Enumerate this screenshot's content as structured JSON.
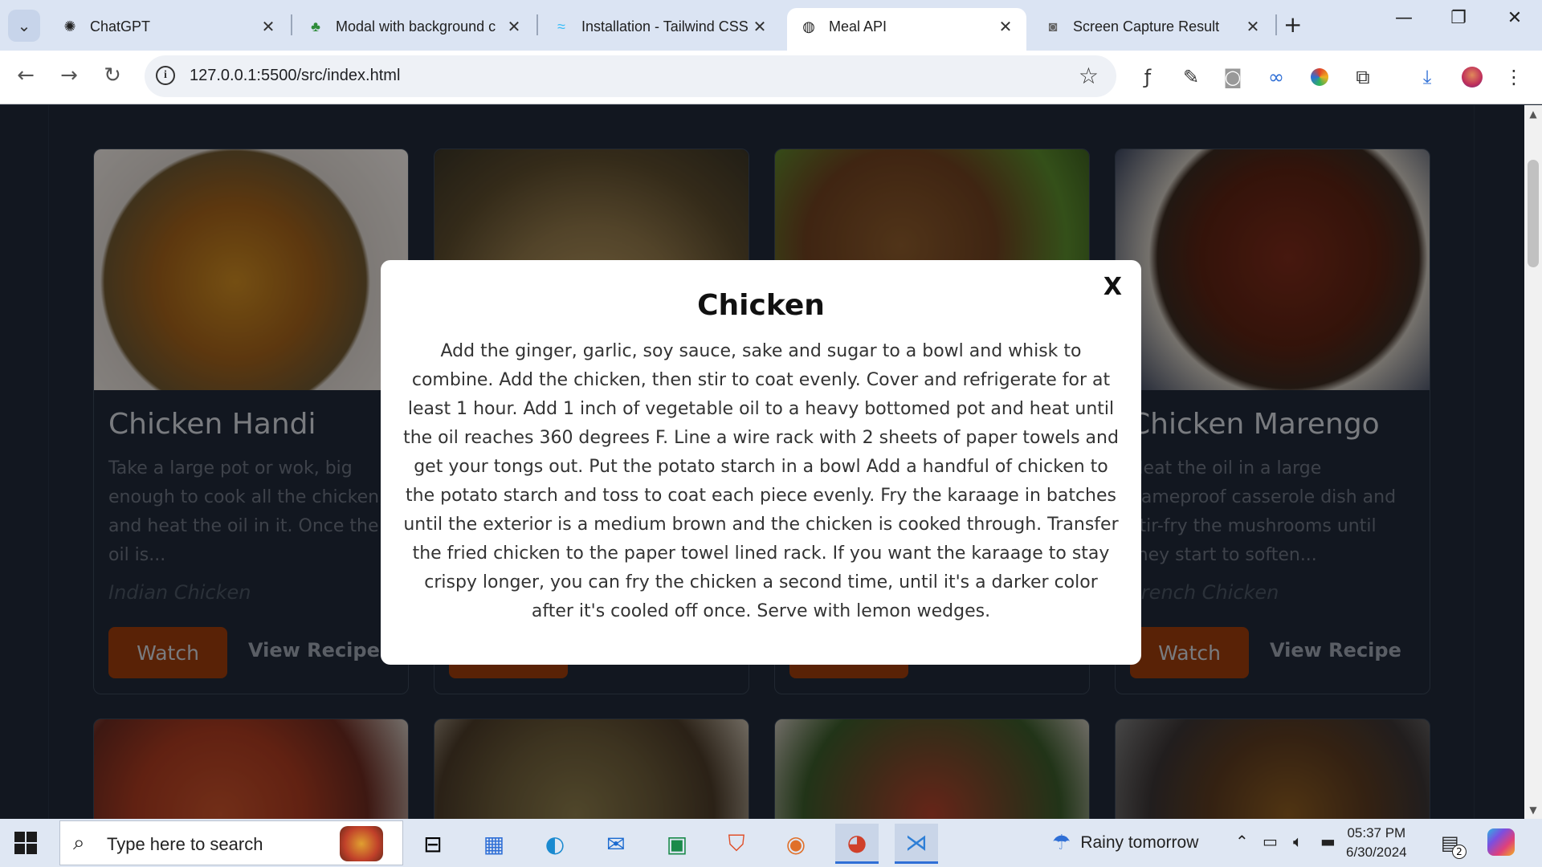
{
  "browser": {
    "tabs": [
      {
        "title": "ChatGPT",
        "icon": "chatgpt-icon",
        "active": false
      },
      {
        "title": "Modal with background c",
        "icon": "leaf-icon",
        "active": false
      },
      {
        "title": "Installation - Tailwind CSS",
        "icon": "tailwind-icon",
        "active": false
      },
      {
        "title": "Meal API",
        "icon": "globe-icon",
        "active": true
      },
      {
        "title": "Screen Capture Result",
        "icon": "camera-icon",
        "active": false
      }
    ],
    "url": "127.0.0.1:5500/src/index.html"
  },
  "cards": [
    {
      "name": "Chicken Handi",
      "description": "Take a large pot or wok, big enough to cook all the chicken, and heat the oil in it. Once the oil is...",
      "category": "Indian Chicken",
      "watch": "Watch",
      "view_recipe": "View Recipe"
    },
    {
      "name": "",
      "description": "",
      "category": "",
      "watch": "",
      "view_recipe": ""
    },
    {
      "name": "",
      "description": "",
      "category": "",
      "watch": "",
      "view_recipe": ""
    },
    {
      "name": "Chicken Marengo",
      "description": "Heat the oil in a large flameproof casserole dish and stir-fry the mushrooms until they start to soften...",
      "category": "French Chicken",
      "watch": "Watch",
      "view_recipe": "View Recipe"
    }
  ],
  "modal": {
    "title": "Chicken",
    "close": "X",
    "body": "Add the ginger, garlic, soy sauce, sake and sugar to a bowl and whisk to combine. Add the chicken, then stir to coat evenly. Cover and refrigerate for at least 1 hour. Add 1 inch of vegetable oil to a heavy bottomed pot and heat until the oil reaches 360 degrees F. Line a wire rack with 2 sheets of paper towels and get your tongs out. Put the potato starch in a bowl Add a handful of chicken to the potato starch and toss to coat each piece evenly. Fry the karaage in batches until the exterior is a medium brown and the chicken is cooked through. Transfer the fried chicken to the paper towel lined rack. If you want the karaage to stay crispy longer, you can fry the chicken a second time, until it's a darker color after it's cooled off once. Serve with lemon wedges."
  },
  "taskbar": {
    "search_placeholder": "Type here to search",
    "weather": "Rainy tomorrow",
    "time": "05:37 PM",
    "date": "6/30/2024",
    "notifications": "2"
  },
  "colors": {
    "page_bg": "#1f2937",
    "watch_button": "#9a3b0b",
    "modal_bg": "#ffffff"
  }
}
